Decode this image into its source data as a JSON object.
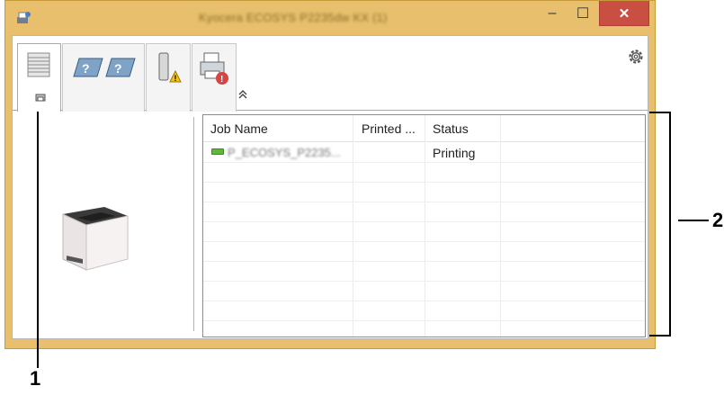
{
  "window": {
    "title": "Kyocera ECOSYS P2235dw KX (1)",
    "controls": {
      "minimize": "–",
      "maximize": "☐",
      "close": "✕"
    }
  },
  "tabs": [
    {
      "name": "print-queue",
      "icon": "stack-of-paper-icon",
      "active": true
    },
    {
      "name": "tray-status",
      "icon": "paper-tray-unknown-icon"
    },
    {
      "name": "toner-status",
      "icon": "toner-warning-icon"
    },
    {
      "name": "printer-status",
      "icon": "printer-alert-icon"
    }
  ],
  "toolbar": {
    "settings_icon": "gear-icon",
    "collapse_icon": "double-chevron-up-icon"
  },
  "job_list": {
    "columns": [
      "Job Name",
      "Printed ...",
      "Status"
    ],
    "rows": [
      {
        "job_name": "P_ECOSYS_P2235...",
        "printed": "",
        "status": "Printing"
      }
    ]
  },
  "callouts": {
    "one": "1",
    "two": "2"
  },
  "colors": {
    "frame": "#e8c06d",
    "close_button": "#c94f42",
    "callout_line": "#c00000",
    "job_icon": "#5fb83a"
  }
}
